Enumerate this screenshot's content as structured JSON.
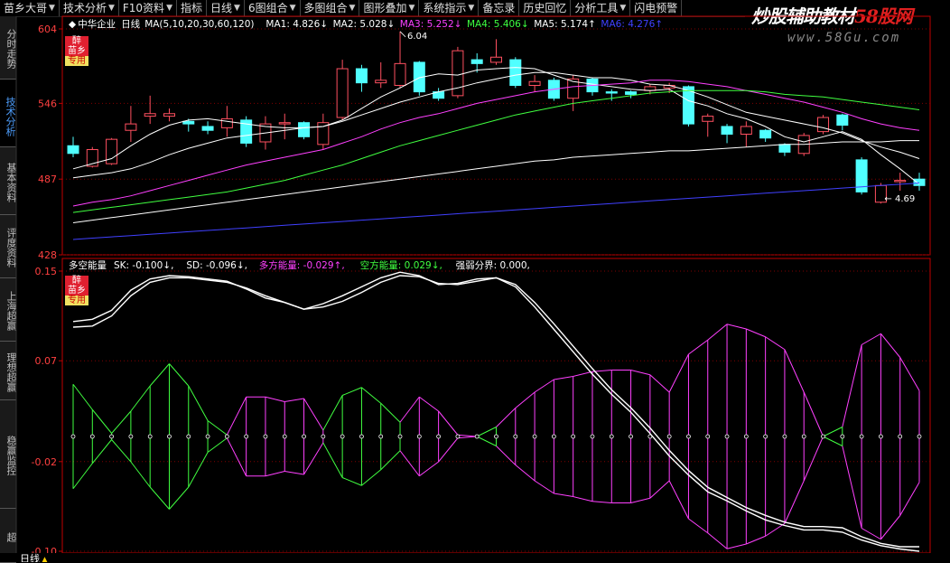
{
  "menu": [
    {
      "label": "苗乡大哥",
      "dropdown": true
    },
    {
      "label": "技术分析",
      "dropdown": true
    },
    {
      "label": "F10资料",
      "dropdown": true
    },
    {
      "label": "指标",
      "dropdown": false
    },
    {
      "label": "日线",
      "dropdown": true
    },
    {
      "label": "6图组合",
      "dropdown": true
    },
    {
      "label": "多图组合",
      "dropdown": true
    },
    {
      "label": "图形叠加",
      "dropdown": true
    },
    {
      "label": "系统指示",
      "dropdown": true
    },
    {
      "label": "备忘录",
      "dropdown": false
    },
    {
      "label": "历史回忆",
      "dropdown": false
    },
    {
      "label": "分析工具",
      "dropdown": true
    },
    {
      "label": "闪电预警",
      "dropdown": false
    }
  ],
  "watermark": {
    "title_white": "炒股辅助教材",
    "title_red": "58股网",
    "url": "www.58Gu.com"
  },
  "side_tabs": [
    {
      "label": "分时走势",
      "active": false
    },
    {
      "label": "技术分析",
      "active": true
    },
    {
      "label": "基本资料",
      "active": false
    },
    {
      "label": "评度资料",
      "active": false
    },
    {
      "label": "上海超赢",
      "active": false
    },
    {
      "label": "理想超赢",
      "active": false
    },
    {
      "label": "稳赢监控",
      "active": false
    },
    {
      "label": "超",
      "active": false
    }
  ],
  "badges": {
    "line1": "醉",
    "line2": "苗乡",
    "line3": "专用"
  },
  "price_panel": {
    "stock_name": "中华企业",
    "period": "日线",
    "ma_params": "MA(5,10,20,30,60,120)",
    "ma_values": [
      {
        "label": "MA1:",
        "value": "4.826",
        "trend": "↓",
        "color": "#ffffff"
      },
      {
        "label": "MA2:",
        "value": "5.028",
        "trend": "↓",
        "color": "#ffffff"
      },
      {
        "label": "MA3:",
        "value": "5.252",
        "trend": "↓",
        "color": "#ff40ff"
      },
      {
        "label": "MA4:",
        "value": "5.406",
        "trend": "↓",
        "color": "#40ff40"
      },
      {
        "label": "MA5:",
        "value": "5.174",
        "trend": "↑",
        "color": "#ffffff"
      },
      {
        "label": "MA6:",
        "value": "4.276",
        "trend": "↑",
        "color": "#4040ff"
      }
    ],
    "y_ticks": [
      "604",
      "546",
      "487",
      "428"
    ],
    "high_label": "6.04",
    "low_label": "4.69"
  },
  "indicator_panel": {
    "name": "多空能量",
    "items": [
      {
        "label": "SK:",
        "value": "-0.100",
        "trend": "↓",
        "color": "#ffffff"
      },
      {
        "label": "SD:",
        "value": "-0.096",
        "trend": "↓",
        "color": "#ffffff"
      },
      {
        "label": "多方能量:",
        "value": "-0.029",
        "trend": "↑",
        "color": "#ff40ff"
      },
      {
        "label": "空方能量:",
        "value": "0.029",
        "trend": "↓",
        "color": "#40ff40"
      },
      {
        "label": "强弱分界:",
        "value": "0.000,",
        "trend": "",
        "color": "#ffffff"
      }
    ],
    "y_ticks": [
      "0.15",
      "0.07",
      "-0.02",
      "-0.10"
    ]
  },
  "status_bar": {
    "label": "日线"
  },
  "chart_data": [
    {
      "type": "candlestick",
      "title": "中华企业 日线",
      "ylim": [
        4.28,
        6.04
      ],
      "candles": [
        {
          "o": 5.13,
          "c": 5.07,
          "h": 5.2,
          "l": 5.04
        },
        {
          "o": 4.97,
          "c": 5.1,
          "h": 5.12,
          "l": 4.96
        },
        {
          "o": 4.99,
          "c": 5.18,
          "h": 5.19,
          "l": 4.98
        },
        {
          "o": 5.25,
          "c": 5.3,
          "h": 5.44,
          "l": 5.16
        },
        {
          "o": 5.36,
          "c": 5.38,
          "h": 5.52,
          "l": 5.3
        },
        {
          "o": 5.36,
          "c": 5.38,
          "h": 5.42,
          "l": 5.32
        },
        {
          "o": 5.32,
          "c": 5.3,
          "h": 5.34,
          "l": 5.24
        },
        {
          "o": 5.28,
          "c": 5.25,
          "h": 5.32,
          "l": 5.22
        },
        {
          "o": 5.27,
          "c": 5.34,
          "h": 5.44,
          "l": 5.2
        },
        {
          "o": 5.33,
          "c": 5.15,
          "h": 5.36,
          "l": 5.12
        },
        {
          "o": 5.16,
          "c": 5.3,
          "h": 5.36,
          "l": 5.1
        },
        {
          "o": 5.3,
          "c": 5.31,
          "h": 5.38,
          "l": 5.18
        },
        {
          "o": 5.31,
          "c": 5.2,
          "h": 5.32,
          "l": 5.18
        },
        {
          "o": 5.14,
          "c": 5.31,
          "h": 5.38,
          "l": 5.1
        },
        {
          "o": 5.35,
          "c": 5.73,
          "h": 5.8,
          "l": 5.33
        },
        {
          "o": 5.73,
          "c": 5.62,
          "h": 5.76,
          "l": 5.55
        },
        {
          "o": 5.62,
          "c": 5.64,
          "h": 5.78,
          "l": 5.58
        },
        {
          "o": 5.6,
          "c": 5.77,
          "h": 6.02,
          "l": 5.58
        },
        {
          "o": 5.78,
          "c": 5.55,
          "h": 5.79,
          "l": 5.52
        },
        {
          "o": 5.55,
          "c": 5.5,
          "h": 5.58,
          "l": 5.48
        },
        {
          "o": 5.52,
          "c": 5.87,
          "h": 5.9,
          "l": 5.5
        },
        {
          "o": 5.8,
          "c": 5.77,
          "h": 5.85,
          "l": 5.7
        },
        {
          "o": 5.78,
          "c": 5.82,
          "h": 5.96,
          "l": 5.76
        },
        {
          "o": 5.8,
          "c": 5.6,
          "h": 5.82,
          "l": 5.58
        },
        {
          "o": 5.6,
          "c": 5.63,
          "h": 5.68,
          "l": 5.55
        },
        {
          "o": 5.64,
          "c": 5.5,
          "h": 5.66,
          "l": 5.48
        },
        {
          "o": 5.5,
          "c": 5.65,
          "h": 5.68,
          "l": 5.4
        },
        {
          "o": 5.65,
          "c": 5.55,
          "h": 5.66,
          "l": 5.52
        },
        {
          "o": 5.55,
          "c": 5.54,
          "h": 5.57,
          "l": 5.48
        },
        {
          "o": 5.55,
          "c": 5.53,
          "h": 5.56,
          "l": 5.5
        },
        {
          "o": 5.56,
          "c": 5.59,
          "h": 5.61,
          "l": 5.53
        },
        {
          "o": 5.58,
          "c": 5.6,
          "h": 5.62,
          "l": 5.54
        },
        {
          "o": 5.59,
          "c": 5.3,
          "h": 5.6,
          "l": 5.28
        },
        {
          "o": 5.32,
          "c": 5.36,
          "h": 5.38,
          "l": 5.2
        },
        {
          "o": 5.28,
          "c": 5.22,
          "h": 5.3,
          "l": 5.15
        },
        {
          "o": 5.22,
          "c": 5.28,
          "h": 5.32,
          "l": 5.12
        },
        {
          "o": 5.25,
          "c": 5.19,
          "h": 5.26,
          "l": 5.16
        },
        {
          "o": 5.14,
          "c": 5.08,
          "h": 5.15,
          "l": 5.05
        },
        {
          "o": 5.07,
          "c": 5.21,
          "h": 5.23,
          "l": 5.05
        },
        {
          "o": 5.24,
          "c": 5.35,
          "h": 5.37,
          "l": 5.22
        },
        {
          "o": 5.37,
          "c": 5.29,
          "h": 5.38,
          "l": 5.25
        },
        {
          "o": 5.02,
          "c": 4.77,
          "h": 5.04,
          "l": 4.75
        },
        {
          "o": 4.69,
          "c": 4.82,
          "h": 4.84,
          "l": 4.68
        },
        {
          "o": 4.85,
          "c": 4.86,
          "h": 4.92,
          "l": 4.78
        },
        {
          "o": 4.87,
          "c": 4.82,
          "h": 4.92,
          "l": 4.78
        }
      ],
      "ma_lines": [
        {
          "name": "MA1",
          "color": "#ffffff",
          "values": [
            4.95,
            4.99,
            5.03,
            5.13,
            5.22,
            5.29,
            5.33,
            5.34,
            5.32,
            5.3,
            5.28,
            5.27,
            5.27,
            5.28,
            5.33,
            5.42,
            5.51,
            5.58,
            5.66,
            5.69,
            5.68,
            5.72,
            5.73,
            5.74,
            5.73,
            5.68,
            5.63,
            5.61,
            5.59,
            5.57,
            5.56,
            5.57,
            5.48,
            5.44,
            5.38,
            5.34,
            5.28,
            5.2,
            5.16,
            5.2,
            5.24,
            5.18,
            5.06,
            4.95,
            4.83
          ]
        },
        {
          "name": "MA2",
          "color": "#ffffff",
          "values": [
            4.88,
            4.9,
            4.92,
            4.95,
            5.0,
            5.06,
            5.11,
            5.15,
            5.19,
            5.21,
            5.23,
            5.25,
            5.27,
            5.28,
            5.32,
            5.37,
            5.42,
            5.47,
            5.51,
            5.55,
            5.58,
            5.62,
            5.65,
            5.68,
            5.7,
            5.7,
            5.68,
            5.66,
            5.66,
            5.64,
            5.61,
            5.6,
            5.56,
            5.51,
            5.45,
            5.39,
            5.36,
            5.33,
            5.3,
            5.27,
            5.23,
            5.17,
            5.12,
            5.08,
            5.03
          ]
        },
        {
          "name": "MA3",
          "color": "#ff40ff",
          "values": [
            4.66,
            4.69,
            4.71,
            4.74,
            4.78,
            4.82,
            4.86,
            4.9,
            4.94,
            4.98,
            5.01,
            5.04,
            5.07,
            5.1,
            5.15,
            5.2,
            5.26,
            5.31,
            5.35,
            5.38,
            5.42,
            5.46,
            5.49,
            5.52,
            5.55,
            5.57,
            5.59,
            5.6,
            5.61,
            5.62,
            5.64,
            5.64,
            5.63,
            5.61,
            5.59,
            5.56,
            5.53,
            5.5,
            5.47,
            5.43,
            5.39,
            5.34,
            5.3,
            5.27,
            5.25
          ]
        },
        {
          "name": "MA4",
          "color": "#40ff40",
          "values": [
            4.61,
            4.63,
            4.65,
            4.67,
            4.69,
            4.71,
            4.73,
            4.75,
            4.77,
            4.8,
            4.83,
            4.86,
            4.9,
            4.94,
            4.98,
            5.03,
            5.08,
            5.13,
            5.17,
            5.21,
            5.25,
            5.29,
            5.33,
            5.37,
            5.4,
            5.43,
            5.46,
            5.48,
            5.5,
            5.52,
            5.54,
            5.55,
            5.56,
            5.56,
            5.56,
            5.56,
            5.55,
            5.53,
            5.52,
            5.51,
            5.49,
            5.47,
            5.45,
            5.43,
            5.41
          ]
        },
        {
          "name": "MA5",
          "color": "#ffffff",
          "values": [
            4.53,
            4.55,
            4.57,
            4.59,
            4.61,
            4.63,
            4.65,
            4.67,
            4.69,
            4.71,
            4.73,
            4.75,
            4.77,
            4.79,
            4.81,
            4.83,
            4.85,
            4.87,
            4.89,
            4.91,
            4.93,
            4.95,
            4.97,
            4.99,
            5.01,
            5.02,
            5.04,
            5.05,
            5.06,
            5.07,
            5.08,
            5.09,
            5.09,
            5.1,
            5.11,
            5.12,
            5.13,
            5.14,
            5.14,
            5.15,
            5.16,
            5.16,
            5.16,
            5.17,
            5.17
          ]
        },
        {
          "name": "MA6",
          "color": "#4040ff",
          "values": [
            4.4,
            4.41,
            4.42,
            4.43,
            4.44,
            4.45,
            4.46,
            4.47,
            4.48,
            4.49,
            4.5,
            4.51,
            4.52,
            4.53,
            4.54,
            4.55,
            4.56,
            4.57,
            4.58,
            4.59,
            4.6,
            4.61,
            4.62,
            4.63,
            4.64,
            4.65,
            4.66,
            4.67,
            4.68,
            4.69,
            4.7,
            4.71,
            4.72,
            4.73,
            4.74,
            4.75,
            4.76,
            4.77,
            4.78,
            4.79,
            4.8,
            4.81,
            4.82,
            4.83,
            4.84
          ]
        }
      ]
    },
    {
      "type": "line",
      "title": "多空能量",
      "ylim": [
        -0.1,
        0.15
      ],
      "series": [
        {
          "name": "SK",
          "color": "#ffffff",
          "values": [
            0.105,
            0.107,
            0.115,
            0.133,
            0.143,
            0.146,
            0.145,
            0.143,
            0.141,
            0.134,
            0.126,
            0.122,
            0.116,
            0.121,
            0.128,
            0.136,
            0.144,
            0.149,
            0.146,
            0.138,
            0.139,
            0.143,
            0.144,
            0.136,
            0.118,
            0.098,
            0.078,
            0.058,
            0.04,
            0.024,
            0.005,
            -0.015,
            -0.032,
            -0.047,
            -0.055,
            -0.064,
            -0.072,
            -0.077,
            -0.081,
            -0.081,
            -0.083,
            -0.09,
            -0.095,
            -0.098,
            -0.1
          ]
        },
        {
          "name": "SD",
          "color": "#ffffff",
          "values": [
            0.1,
            0.101,
            0.11,
            0.128,
            0.14,
            0.144,
            0.144,
            0.142,
            0.14,
            0.135,
            0.128,
            0.122,
            0.116,
            0.118,
            0.123,
            0.131,
            0.14,
            0.146,
            0.145,
            0.139,
            0.138,
            0.141,
            0.144,
            0.138,
            0.122,
            0.103,
            0.083,
            0.063,
            0.044,
            0.028,
            0.01,
            -0.01,
            -0.028,
            -0.043,
            -0.052,
            -0.061,
            -0.068,
            -0.074,
            -0.078,
            -0.078,
            -0.079,
            -0.087,
            -0.093,
            -0.096,
            -0.096
          ]
        },
        {
          "name": "多方能量",
          "color": "#ff40ff",
          "values": [
            0.033,
            0.017,
            0.002,
            0.016,
            0.032,
            0.046,
            0.032,
            0.01,
            0.001,
            -0.025,
            -0.025,
            -0.022,
            -0.024,
            -0.004,
            0.026,
            0.031,
            0.021,
            0.009,
            -0.025,
            -0.016,
            -0.001,
            0.0,
            0.006,
            -0.018,
            -0.028,
            -0.036,
            -0.038,
            -0.041,
            -0.042,
            -0.042,
            -0.039,
            -0.028,
            -0.052,
            -0.061,
            -0.071,
            -0.068,
            -0.063,
            -0.055,
            -0.028,
            0.0,
            0.006,
            -0.058,
            -0.065,
            -0.05,
            -0.029
          ]
        },
        {
          "name": "空方能量",
          "color": "#40ff40",
          "values": [
            -0.033,
            -0.017,
            -0.002,
            -0.016,
            -0.032,
            -0.046,
            -0.032,
            -0.01,
            -0.001,
            0.025,
            0.025,
            0.022,
            0.024,
            0.004,
            -0.026,
            -0.031,
            -0.021,
            -0.009,
            0.025,
            0.016,
            0.001,
            0.0,
            -0.006,
            0.018,
            0.028,
            0.036,
            0.038,
            0.041,
            0.042,
            0.042,
            0.039,
            0.028,
            0.052,
            0.061,
            0.071,
            0.068,
            0.063,
            0.055,
            0.028,
            0.0,
            -0.006,
            0.058,
            0.065,
            0.05,
            0.029
          ]
        },
        {
          "name": "强弱分界",
          "color": "#ffffff",
          "values": [
            0.0,
            0.0,
            0.0,
            0.0,
            0.0,
            0.0,
            0.0,
            0.0,
            0.0,
            0.0,
            0.0,
            0.0,
            0.0,
            0.0,
            0.0,
            0.0,
            0.0,
            0.0,
            0.0,
            0.0,
            0.0,
            0.0,
            0.0,
            0.0,
            0.0,
            0.0,
            0.0,
            0.0,
            0.0,
            0.0,
            0.0,
            0.0,
            0.0,
            0.0,
            0.0,
            0.0,
            0.0,
            0.0,
            0.0,
            0.0,
            0.0,
            0.0,
            0.0,
            0.0,
            0.0
          ]
        }
      ]
    }
  ]
}
